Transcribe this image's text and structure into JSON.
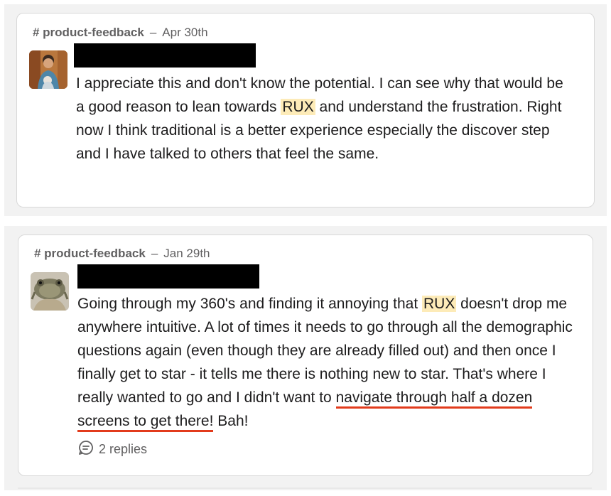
{
  "messages": [
    {
      "channel": "# product-feedback",
      "date": "Apr 30th",
      "text_before": "I appreciate this and don't know the potential. I can see why that would be a good reason to lean towards ",
      "highlight": "RUX",
      "text_after": " and understand the frustration. Right now I think traditional is a better experience especially the discover step and I have talked to others that feel the same."
    },
    {
      "channel": "# product-feedback",
      "date": "Jan 29th",
      "text_before": "Going through my 360's and finding it annoying that ",
      "highlight": "RUX",
      "text_middle": " doesn't drop me anywhere intuitive. A lot of times it needs to go through all the demographic questions again (even though they are already filled out) and then once I finally get to star - it tells me there is nothing new to star. That's where I really wanted to go and I didn't want to ",
      "underlined": "navigate through half a dozen screens to get there!",
      "text_after": " Bah!",
      "replies": "2 replies"
    }
  ],
  "colors": {
    "highlight": "#fdebb8",
    "underline": "#e23b1c",
    "panel": "#f2f2f2",
    "muted_text": "#616061"
  },
  "icons": {
    "replies": "thread-bubble-icon"
  }
}
